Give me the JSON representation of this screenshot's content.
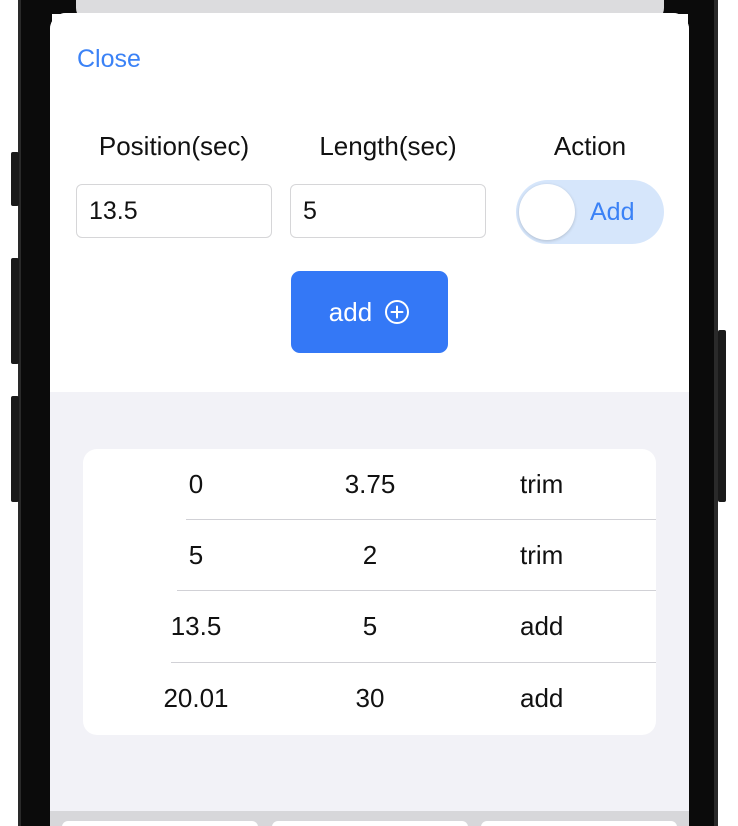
{
  "sheet": {
    "close_label": "Close",
    "columns": {
      "position_label": "Position(sec)",
      "length_label": "Length(sec)",
      "action_label": "Action"
    },
    "inputs": {
      "position_value": "13.5",
      "length_value": "5"
    },
    "action_toggle": {
      "label": "Add"
    },
    "add_button": {
      "label": "add",
      "icon": "plus-circle-icon"
    }
  },
  "entries": [
    {
      "position": "0",
      "length": "3.75",
      "action": "trim"
    },
    {
      "position": "5",
      "length": "2",
      "action": "trim"
    },
    {
      "position": "13.5",
      "length": "5",
      "action": "add"
    },
    {
      "position": "20.01",
      "length": "30",
      "action": "add"
    }
  ],
  "colors": {
    "accent": "#3478f6",
    "toggle_bg": "#d6e6fb",
    "grouped_bg": "#f2f2f7"
  }
}
